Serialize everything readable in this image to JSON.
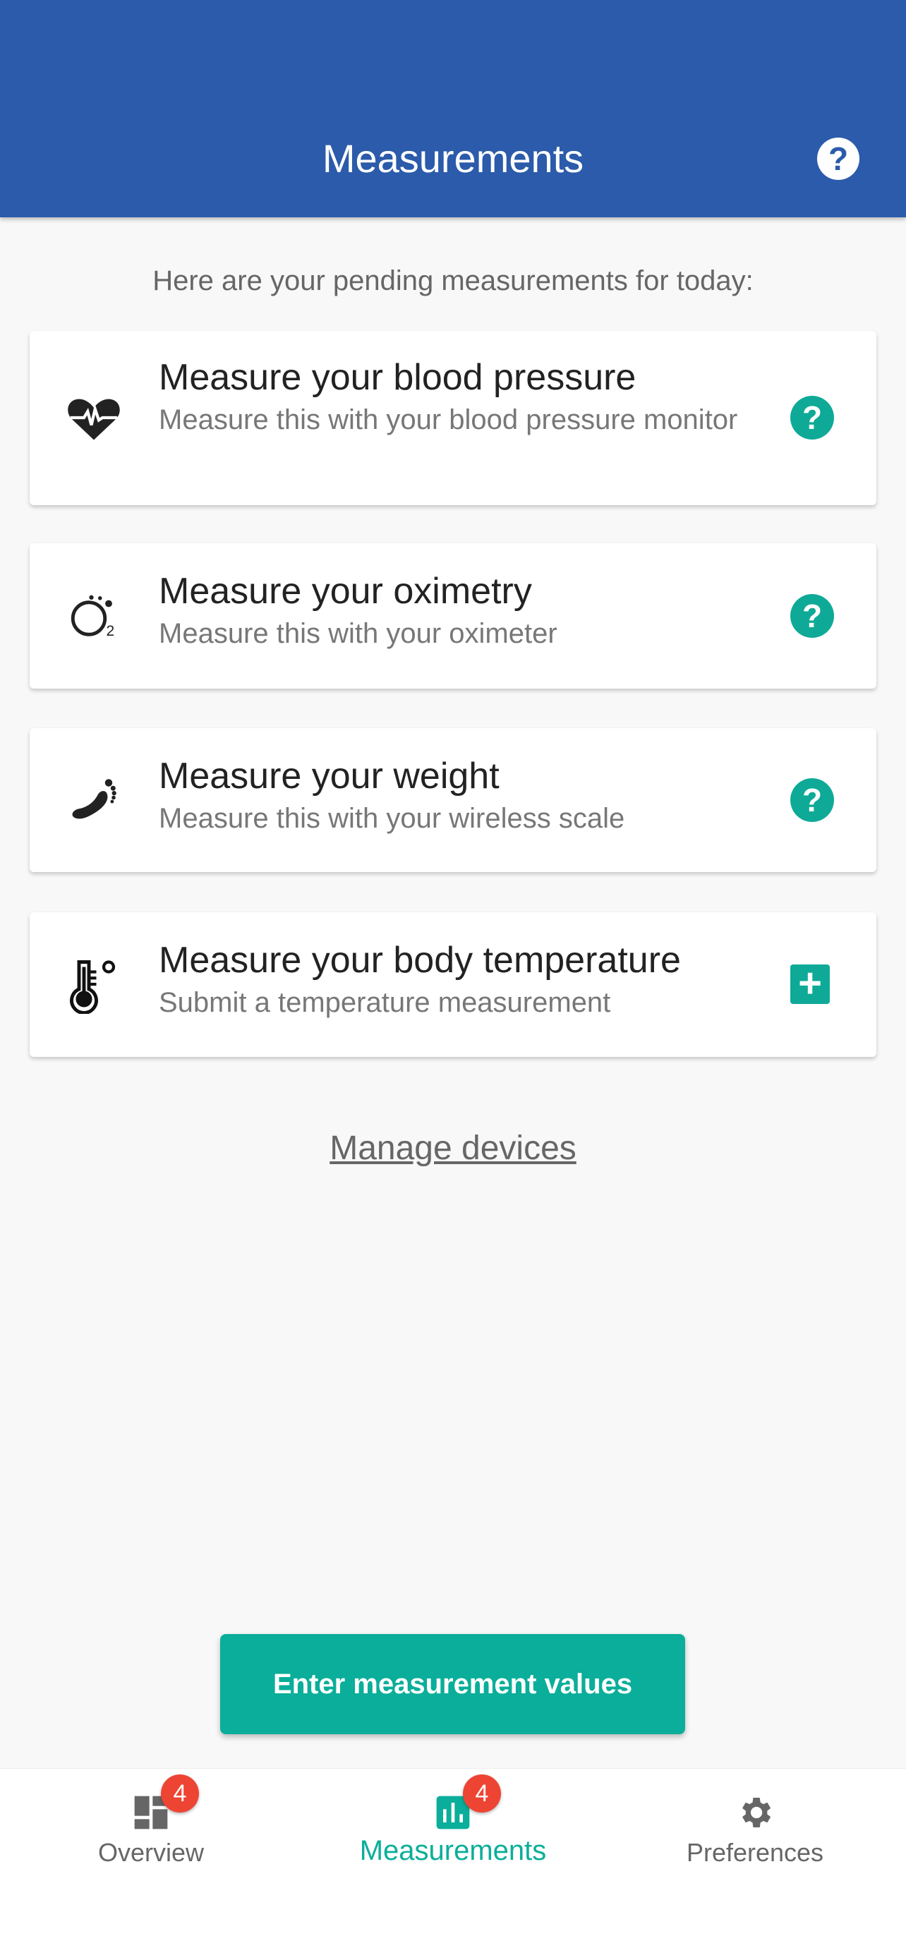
{
  "header": {
    "title": "Measurements",
    "help_icon": "question-circle-icon",
    "color": "#2B5BAA"
  },
  "intro": "Here are your pending measurements for today:",
  "measurements": [
    {
      "title": "Measure your blood pressure",
      "subtitle": "Measure this with your blood pressure monitor",
      "icon": "heart-pulse-icon",
      "action": "help"
    },
    {
      "title": "Measure your oximetry",
      "subtitle": "Measure this with your oximeter",
      "icon": "oxygen-icon",
      "action": "help"
    },
    {
      "title": "Measure your weight",
      "subtitle": "Measure this with your wireless scale",
      "icon": "foot-icon",
      "action": "help"
    },
    {
      "title": "Measure your body temperature",
      "subtitle": "Submit a temperature measurement",
      "icon": "thermometer-icon",
      "action": "add"
    }
  ],
  "manage_devices": "Manage devices",
  "enter_button": "Enter measurement values",
  "accent": "#0AAE9A",
  "nav": {
    "items": [
      {
        "label": "Overview",
        "badge": "4",
        "icon": "dashboard-icon"
      },
      {
        "label": "Measurements",
        "badge": "4",
        "icon": "bar-chart-icon",
        "active": true
      },
      {
        "label": "Preferences",
        "icon": "gear-icon"
      }
    ]
  }
}
